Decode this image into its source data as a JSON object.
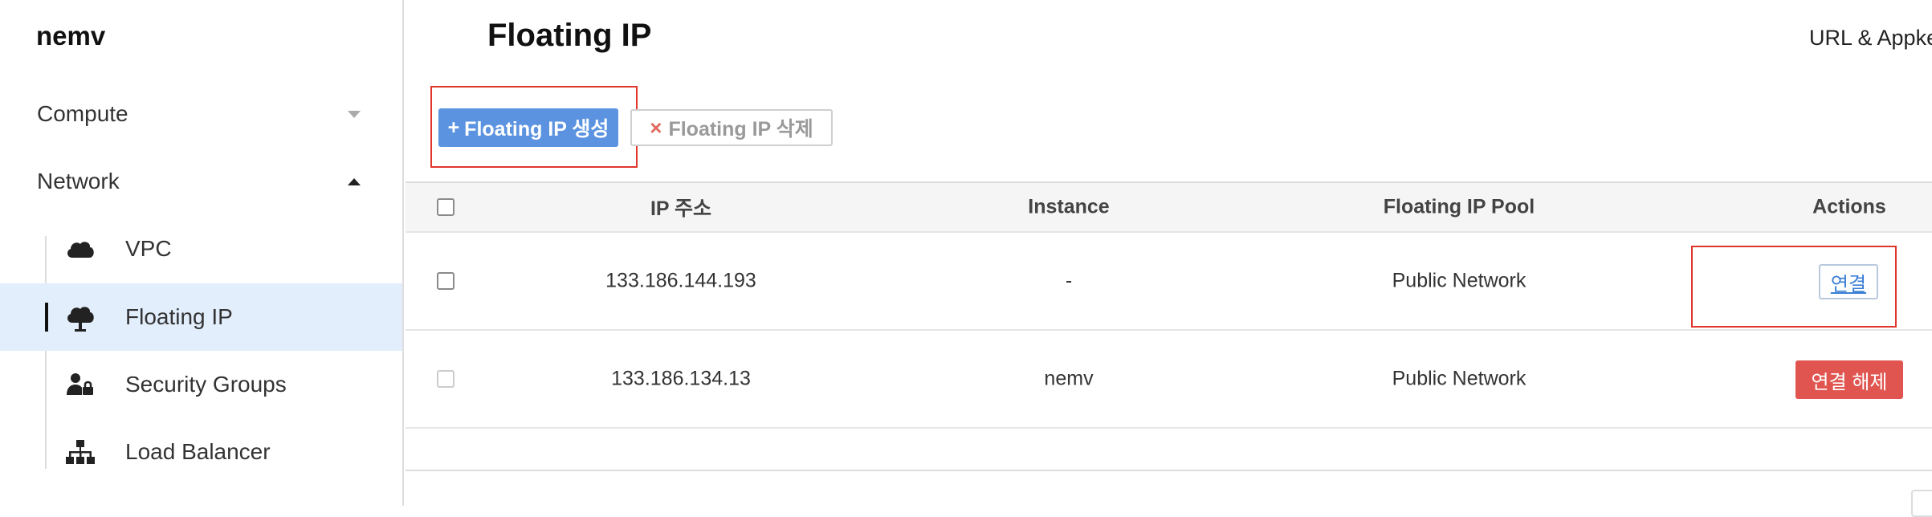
{
  "sidebar": {
    "brand": "nemv",
    "groups": [
      {
        "label": "Compute",
        "icon": "caret-down-icon"
      },
      {
        "label": "Network",
        "icon": "caret-up-icon"
      }
    ],
    "items": [
      {
        "label": "VPC",
        "icon": "cloud-icon"
      },
      {
        "label": "Floating IP",
        "icon": "cloud-upload-icon",
        "active": true
      },
      {
        "label": "Security Groups",
        "icon": "user-lock-icon"
      },
      {
        "label": "Load Balancer",
        "icon": "sitemap-icon"
      }
    ]
  },
  "header": {
    "title": "Floating IP",
    "top_link": "URL & Appke"
  },
  "toolbar": {
    "create_icon": "+",
    "create_label": "Floating IP 생성",
    "delete_icon": "×",
    "delete_label": "Floating IP 삭제"
  },
  "table": {
    "columns": [
      "IP 주소",
      "Instance",
      "Floating IP Pool",
      "Actions"
    ],
    "rows": [
      {
        "ip": "133.186.144.193",
        "instance": "-",
        "pool": "Public Network",
        "action": "연결"
      },
      {
        "ip": "133.186.134.13",
        "instance": "nemv",
        "pool": "Public Network",
        "action": "연결 해제"
      }
    ]
  },
  "colors": {
    "primary": "#5b93e0",
    "danger": "#e05550",
    "active_bg": "#e3eefc",
    "annotation": "#e0362c"
  }
}
